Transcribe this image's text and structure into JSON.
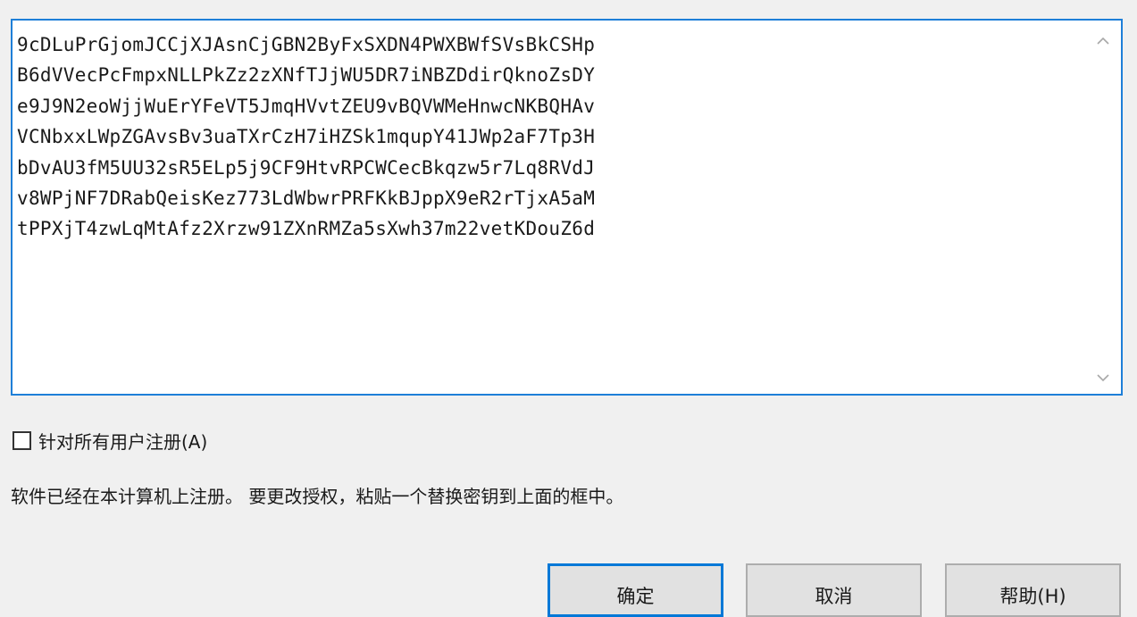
{
  "license_key": {
    "lines": [
      "9cDLuPrGjomJCCjXJAsnCjGBN2ByFxSXDN4PWXBWfSVsBkCSHp",
      "B6dVVecPcFmpxNLLPkZz2zXNfTJjWU5DR7iNBZDdirQknoZsDY",
      "e9J9N2eoWjjWuErYFeVT5JmqHVvtZEU9vBQVWMeHnwcNKBQHAv",
      "VCNbxxLWpZGAvsBv3uaTXrCzH7iHZSk1mqupY41JWp2aF7Tp3H",
      "bDvAU3fM5UU32sR5ELp5j9CF9HtvRPCWCecBkqzw5r7Lq8RVdJ",
      "v8WPjNF7DRabQeisKez773LdWbwrPRFKkBJppX9eR2rTjxA5aM",
      "tPPXjT4zwLqMtAfz2Xrzw91ZXnRMZa5sXwh37m22vetKDouZ6d"
    ],
    "scroll_up_icon": "chevron-up-icon",
    "scroll_down_icon": "chevron-down-icon"
  },
  "all_users_checkbox": {
    "label": "针对所有用户注册(A)",
    "checked": false
  },
  "status_message": "软件已经在本计算机上注册。 要更改授权，粘贴一个替换密钥到上面的框中。",
  "buttons": {
    "ok": "确定",
    "cancel": "取消",
    "help": "帮助(H)"
  },
  "colors": {
    "focus_border": "#1e7fd8",
    "default_button_border": "#0078d7",
    "dialog_background": "#f0f0f0"
  }
}
